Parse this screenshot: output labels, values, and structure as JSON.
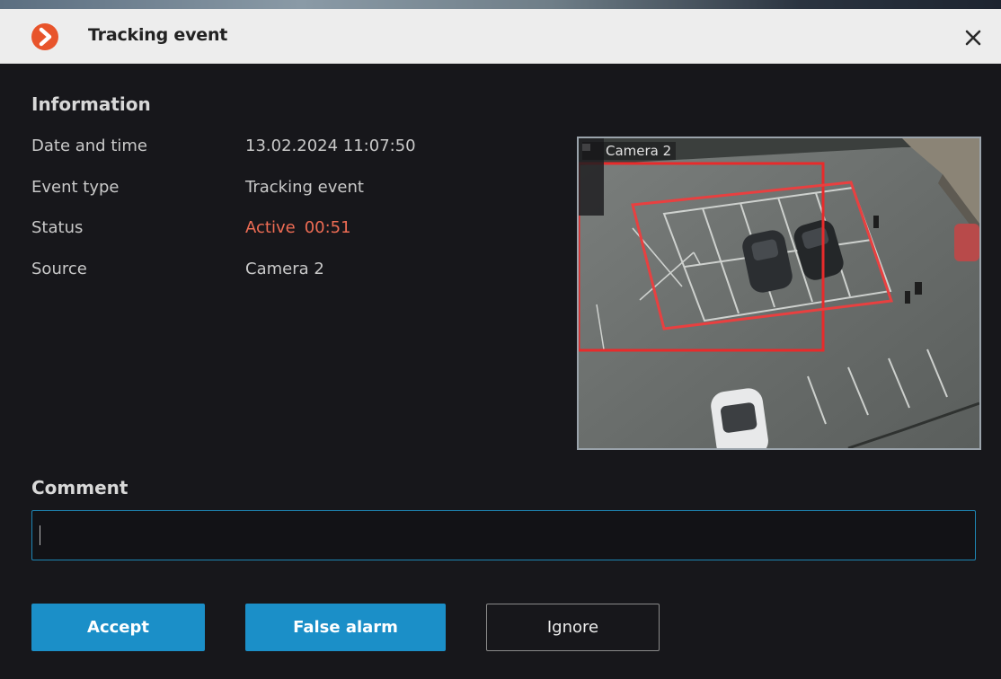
{
  "window": {
    "title": "Tracking event",
    "logo_icon": "app-logo-arrow-icon",
    "close_icon": "close-icon",
    "accent_color": "#e8542b"
  },
  "information": {
    "heading": "Information",
    "rows": [
      {
        "label": "Date and time",
        "value": "13.02.2024 11:07:50"
      },
      {
        "label": "Event type",
        "value": "Tracking event"
      },
      {
        "label": "Status",
        "value": "Active",
        "timer": "00:51",
        "color": "#ee6c54"
      },
      {
        "label": "Source",
        "value": "Camera 2"
      }
    ]
  },
  "camera": {
    "name": "Camera 2",
    "icon": "camera-icon",
    "zone_color": "#e82b2b"
  },
  "comment": {
    "heading": "Comment",
    "value": "",
    "placeholder": "",
    "border_color": "#1e86b5"
  },
  "actions": {
    "accept_label": "Accept",
    "false_alarm_label": "False alarm",
    "ignore_label": "Ignore",
    "primary_color": "#1b8fc8"
  }
}
